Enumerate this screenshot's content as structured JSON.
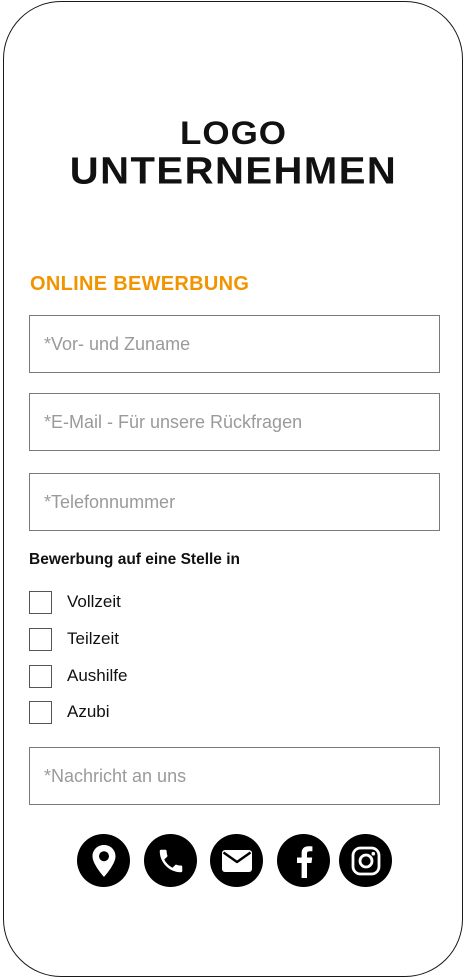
{
  "logo": {
    "line1": "LOGO",
    "line2": "UNTERNEHMEN"
  },
  "form": {
    "title": "ONLINE BEWERBUNG",
    "name_placeholder": "*Vor- und Zuname",
    "email_placeholder": "*E-Mail - Für unsere Rückfragen",
    "phone_placeholder": "*Telefonnummer",
    "message_placeholder": "*Nachricht an uns",
    "position_group_label": "Bewerbung auf eine Stelle in",
    "options": [
      {
        "label": "Vollzeit",
        "checked": false
      },
      {
        "label": "Teilzeit",
        "checked": false
      },
      {
        "label": "Aushilfe",
        "checked": false
      },
      {
        "label": "Azubi",
        "checked": false
      }
    ]
  },
  "social_icons": [
    "location-icon",
    "phone-icon",
    "mail-icon",
    "facebook-icon",
    "instagram-icon"
  ],
  "colors": {
    "accent": "#f29400",
    "icon_background": "#000000",
    "text": "#111111",
    "placeholder": "#9a9a9a"
  }
}
